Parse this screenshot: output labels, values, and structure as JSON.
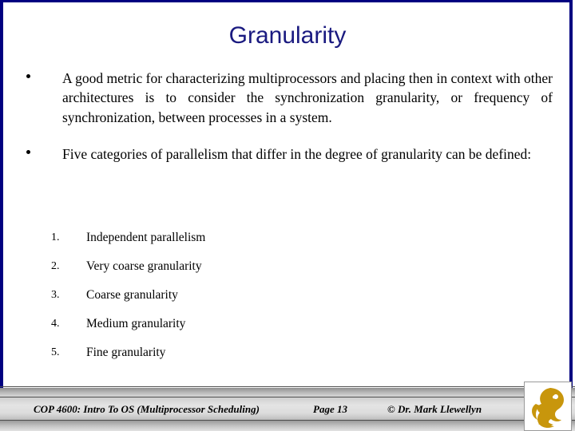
{
  "slide": {
    "title": "Granularity",
    "title_color": "#1a1a80",
    "border_color": "#000080",
    "background_color": "#ffffff"
  },
  "bullets": [
    {
      "marker": "•",
      "text": "A good metric for characterizing multiprocessors and placing then in context with other architectures is to consider the synchronization granularity, or frequency of synchronization, between processes in a system."
    },
    {
      "marker": "•",
      "text": "Five categories of parallelism that differ in the degree of granularity can be defined:"
    }
  ],
  "numbered_list": [
    {
      "marker": "1.",
      "label": "Independent parallelism"
    },
    {
      "marker": "2.",
      "label": "Very coarse granularity"
    },
    {
      "marker": "3.",
      "label": "Coarse granularity"
    },
    {
      "marker": "4.",
      "label": "Medium granularity"
    },
    {
      "marker": "5.",
      "label": "Fine granularity"
    }
  ],
  "footer": {
    "course": "COP 4600: Intro To OS  (Multiprocessor Scheduling)",
    "page": "Page 13",
    "credit": "© Dr. Mark Llewellyn",
    "logo_name": "ucf-pegasus-logo",
    "logo_color": "#c8960c"
  }
}
